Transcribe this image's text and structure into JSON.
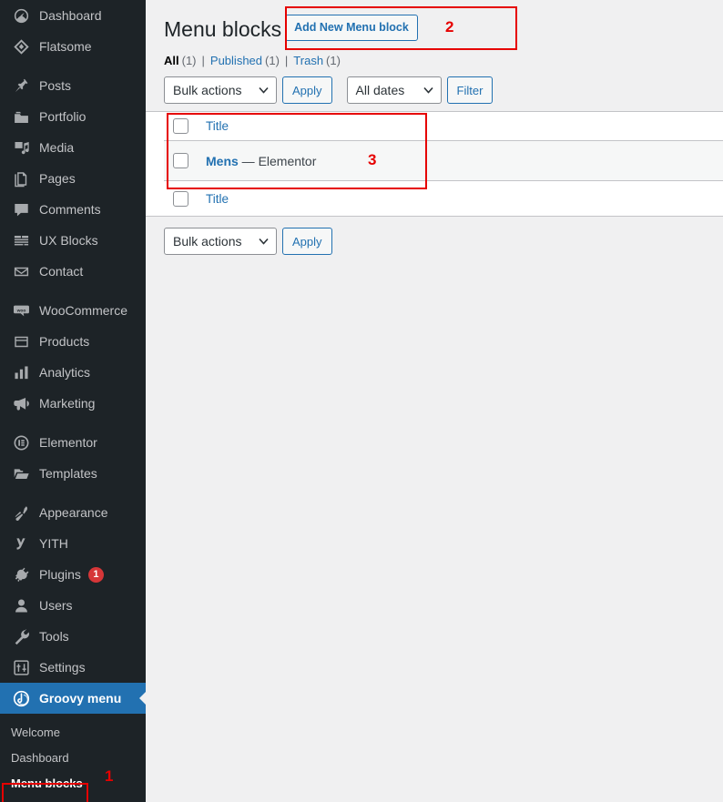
{
  "sidebar": {
    "items": [
      {
        "label": "Dashboard",
        "icon": "dashboard-icon",
        "active": false,
        "gap_after": false
      },
      {
        "label": "Flatsome",
        "icon": "flatsome-icon",
        "active": false,
        "gap_after": true
      },
      {
        "label": "Posts",
        "icon": "pin-icon",
        "active": false,
        "gap_after": false
      },
      {
        "label": "Portfolio",
        "icon": "portfolio-icon",
        "active": false,
        "gap_after": false
      },
      {
        "label": "Media",
        "icon": "media-icon",
        "active": false,
        "gap_after": false
      },
      {
        "label": "Pages",
        "icon": "pages-icon",
        "active": false,
        "gap_after": false
      },
      {
        "label": "Comments",
        "icon": "comment-icon",
        "active": false,
        "gap_after": false
      },
      {
        "label": "UX Blocks",
        "icon": "ux-blocks-icon",
        "active": false,
        "gap_after": false
      },
      {
        "label": "Contact",
        "icon": "envelope-icon",
        "active": false,
        "gap_after": true
      },
      {
        "label": "WooCommerce",
        "icon": "woocommerce-icon",
        "active": false,
        "gap_after": false
      },
      {
        "label": "Products",
        "icon": "products-icon",
        "active": false,
        "gap_after": false
      },
      {
        "label": "Analytics",
        "icon": "analytics-icon",
        "active": false,
        "gap_after": false
      },
      {
        "label": "Marketing",
        "icon": "megaphone-icon",
        "active": false,
        "gap_after": true
      },
      {
        "label": "Elementor",
        "icon": "elementor-icon",
        "active": false,
        "gap_after": false
      },
      {
        "label": "Templates",
        "icon": "folder-icon",
        "active": false,
        "gap_after": true
      },
      {
        "label": "Appearance",
        "icon": "brush-icon",
        "active": false,
        "gap_after": false
      },
      {
        "label": "YITH",
        "icon": "yith-icon",
        "active": false,
        "gap_after": false
      },
      {
        "label": "Plugins",
        "icon": "plug-icon",
        "active": false,
        "gap_after": false,
        "badge": "1"
      },
      {
        "label": "Users",
        "icon": "user-icon",
        "active": false,
        "gap_after": false
      },
      {
        "label": "Tools",
        "icon": "wrench-icon",
        "active": false,
        "gap_after": false
      },
      {
        "label": "Settings",
        "icon": "sliders-icon",
        "active": false,
        "gap_after": false
      },
      {
        "label": "Groovy menu",
        "icon": "groovy-icon",
        "active": true,
        "gap_after": false
      }
    ],
    "submenu": [
      {
        "label": "Welcome",
        "current": false
      },
      {
        "label": "Dashboard",
        "current": false
      },
      {
        "label": "Menu blocks",
        "current": true
      }
    ]
  },
  "header": {
    "title": "Menu blocks",
    "add_new_label": "Add New Menu block"
  },
  "views": {
    "all_label": "All",
    "all_count": "(1)",
    "published_label": "Published",
    "published_count": "(1)",
    "trash_label": "Trash",
    "trash_count": "(1)",
    "separator": "|"
  },
  "tablenav_top": {
    "bulk_actions_label": "Bulk actions",
    "apply_label": "Apply",
    "all_dates_label": "All dates",
    "filter_label": "Filter"
  },
  "tablenav_bottom": {
    "bulk_actions_label": "Bulk actions",
    "apply_label": "Apply"
  },
  "table": {
    "header_title": "Title",
    "footer_title": "Title",
    "rows": [
      {
        "link": "Mens",
        "suffix": " — Elementor"
      }
    ]
  },
  "annotations": [
    {
      "number": "1",
      "target": "sidebar-menu-blocks"
    },
    {
      "number": "2",
      "target": "add-new-menu-block-button"
    },
    {
      "number": "3",
      "target": "menu-blocks-table"
    }
  ],
  "colors": {
    "sidebar_bg": "#1d2327",
    "accent": "#2271b1",
    "annotation": "#e60000",
    "page_bg": "#f0f0f1",
    "badge": "#d63638"
  }
}
